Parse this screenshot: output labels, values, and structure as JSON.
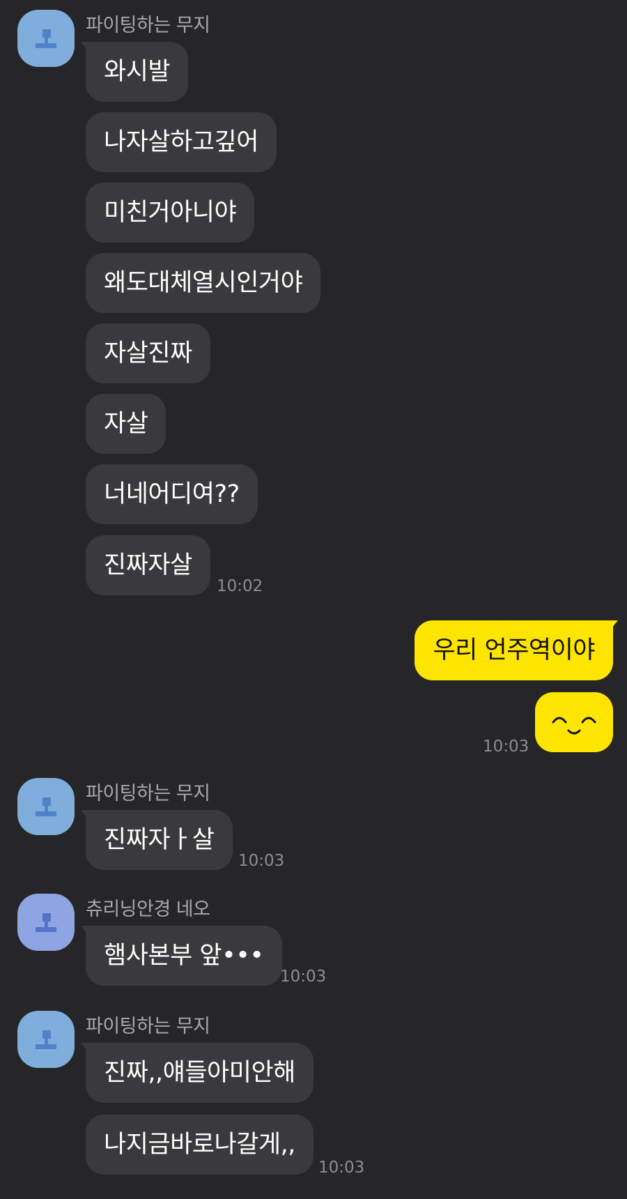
{
  "colors": {
    "background": "#262628",
    "bubble_other": "#3A3A3D",
    "bubble_mine": "#FEE500",
    "sender_text": "#A9A9AD",
    "time_text": "#8E8E92",
    "avatar_blue": "#7FAEDD",
    "avatar_purple": "#8FA5E3"
  },
  "chat": {
    "group1": {
      "sender": "파이팅하는 무지",
      "avatar_icon": "default-profile-icon",
      "messages": [
        "와시발",
        "나자살하고깊어",
        "미친거아니야",
        "왜도대체열시인거야",
        "자살진짜",
        "자살",
        "너네어디여??",
        "진짜자살"
      ],
      "time": "10:02"
    },
    "mine": {
      "messages": [
        "우리 언주역이야"
      ],
      "emoticon": "smiling-eyes-emoticon-icon",
      "time": "10:03"
    },
    "group2": {
      "sender": "파이팅하는 무지",
      "avatar_icon": "default-profile-icon",
      "messages": [
        "진짜자ㅏ살"
      ],
      "time": "10:03"
    },
    "group3": {
      "sender": "츄리닝안경 네오",
      "avatar_icon": "default-profile-icon",
      "messages": [
        "햄사본부 앞•••"
      ],
      "time": "10:03"
    },
    "group4": {
      "sender": "파이팅하는 무지",
      "avatar_icon": "default-profile-icon",
      "messages": [
        "진짜,,얘들아미안해",
        "나지금바로나갈게,,"
      ],
      "time": "10:03"
    }
  }
}
